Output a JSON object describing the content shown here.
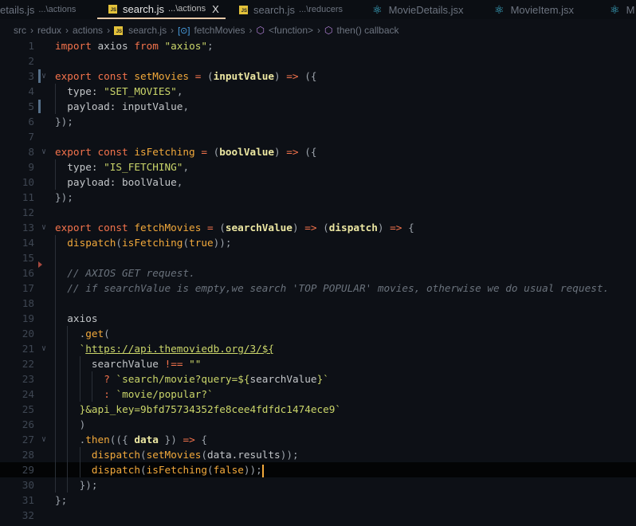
{
  "tabs": [
    {
      "name": "etails.js",
      "desc": "...\\actions",
      "icon": "js"
    },
    {
      "name": "search.js",
      "desc": "...\\actions",
      "icon": "js",
      "active": true,
      "close": "X"
    },
    {
      "name": "search.js",
      "desc": "...\\reducers",
      "icon": "js"
    },
    {
      "name": "MovieDetails.jsx",
      "desc": "",
      "icon": "react"
    },
    {
      "name": "MovieItem.jsx",
      "desc": "",
      "icon": "react"
    },
    {
      "name": "M",
      "desc": "",
      "icon": "react"
    }
  ],
  "breadcrumb": [
    "src",
    "redux",
    "actions",
    "search.js",
    "fetchMovies",
    "<function>",
    "then() callback"
  ],
  "code": [
    {
      "n": "1",
      "i": 0,
      "t": [
        [
          "kw",
          "import"
        ],
        [
          "pl",
          " axios "
        ],
        [
          "kw",
          "from"
        ],
        [
          "st",
          " \"axios\""
        ],
        [
          "pu",
          ";"
        ]
      ]
    },
    {
      "n": "2",
      "i": 0,
      "t": []
    },
    {
      "n": "3",
      "i": 0,
      "fold": true,
      "mod": true,
      "t": [
        [
          "kw",
          "export const "
        ],
        [
          "fn",
          "setMovies"
        ],
        [
          "kw",
          " = "
        ],
        [
          "pu",
          "("
        ],
        [
          "pa",
          "inputValue"
        ],
        [
          "pu",
          ") "
        ],
        [
          "kw",
          "=>"
        ],
        [
          "pu",
          " ({"
        ]
      ]
    },
    {
      "n": "4",
      "i": 1,
      "t": [
        [
          "pl",
          "type: "
        ],
        [
          "st",
          "\"SET_MOVIES\""
        ],
        [
          "pu",
          ","
        ]
      ]
    },
    {
      "n": "5",
      "i": 1,
      "mod": true,
      "t": [
        [
          "pl",
          "payload: inputValue"
        ],
        [
          "pu",
          ","
        ]
      ]
    },
    {
      "n": "6",
      "i": 0,
      "t": [
        [
          "pu",
          "});"
        ]
      ]
    },
    {
      "n": "7",
      "i": 0,
      "t": []
    },
    {
      "n": "8",
      "i": 0,
      "fold": true,
      "t": [
        [
          "kw",
          "export const "
        ],
        [
          "fn",
          "isFetching"
        ],
        [
          "kw",
          " = "
        ],
        [
          "pu",
          "("
        ],
        [
          "pa",
          "boolValue"
        ],
        [
          "pu",
          ") "
        ],
        [
          "kw",
          "=>"
        ],
        [
          "pu",
          " ({"
        ]
      ]
    },
    {
      "n": "9",
      "i": 1,
      "t": [
        [
          "pl",
          "type: "
        ],
        [
          "st",
          "\"IS_FETCHING\""
        ],
        [
          "pu",
          ","
        ]
      ]
    },
    {
      "n": "10",
      "i": 1,
      "t": [
        [
          "pl",
          "payload: boolValue"
        ],
        [
          "pu",
          ","
        ]
      ]
    },
    {
      "n": "11",
      "i": 0,
      "t": [
        [
          "pu",
          "});"
        ]
      ]
    },
    {
      "n": "12",
      "i": 0,
      "t": []
    },
    {
      "n": "13",
      "i": 0,
      "fold": true,
      "t": [
        [
          "kw",
          "export const "
        ],
        [
          "fn",
          "fetchMovies"
        ],
        [
          "kw",
          " = "
        ],
        [
          "pu",
          "("
        ],
        [
          "pa",
          "searchValue"
        ],
        [
          "pu",
          ") "
        ],
        [
          "kw",
          "=>"
        ],
        [
          "pu",
          " ("
        ],
        [
          "pa",
          "dispatch"
        ],
        [
          "pu",
          ") "
        ],
        [
          "kw",
          "=>"
        ],
        [
          "pu",
          " {"
        ]
      ]
    },
    {
      "n": "14",
      "i": 1,
      "t": [
        [
          "fn",
          "dispatch"
        ],
        [
          "pu",
          "("
        ],
        [
          "fn",
          "isFetching"
        ],
        [
          "pu",
          "("
        ],
        [
          "fn",
          "true"
        ],
        [
          "pu",
          "));"
        ]
      ]
    },
    {
      "n": "15",
      "i": 1,
      "del": true,
      "t": []
    },
    {
      "n": "16",
      "i": 1,
      "t": [
        [
          "cm",
          "// AXIOS GET request."
        ]
      ]
    },
    {
      "n": "17",
      "i": 1,
      "t": [
        [
          "cm",
          "// if searchValue is empty,we search 'TOP POPULAR' movies, otherwise we do usual request."
        ]
      ]
    },
    {
      "n": "18",
      "i": 1,
      "t": []
    },
    {
      "n": "19",
      "i": 1,
      "t": [
        [
          "pl",
          "axios"
        ]
      ]
    },
    {
      "n": "20",
      "i": 2,
      "t": [
        [
          "pu",
          "."
        ],
        [
          "fn",
          "get"
        ],
        [
          "pu",
          "("
        ]
      ]
    },
    {
      "n": "21",
      "i": 2,
      "fold": true,
      "t": [
        [
          "st",
          "`"
        ],
        [
          "ln2",
          "https://api.themoviedb.org/3/${"
        ]
      ]
    },
    {
      "n": "22",
      "i": 3,
      "t": [
        [
          "pl",
          "searchValue "
        ],
        [
          "kw",
          "!=="
        ],
        [
          "st",
          " \"\""
        ]
      ]
    },
    {
      "n": "23",
      "i": 4,
      "t": [
        [
          "kw",
          "? "
        ],
        [
          "st",
          "`search/movie?query=${"
        ],
        [
          "pl",
          "searchValue"
        ],
        [
          "st",
          "}`"
        ]
      ]
    },
    {
      "n": "24",
      "i": 4,
      "t": [
        [
          "kw",
          ": "
        ],
        [
          "st",
          "`movie/popular?`"
        ]
      ]
    },
    {
      "n": "25",
      "i": 2,
      "t": [
        [
          "st",
          "}&api_key=9bfd75734352fe8cee4fdfdc1474ece9`"
        ]
      ]
    },
    {
      "n": "26",
      "i": 2,
      "t": [
        [
          "pu",
          ")"
        ]
      ]
    },
    {
      "n": "27",
      "i": 2,
      "fold": true,
      "t": [
        [
          "pu",
          "."
        ],
        [
          "fn",
          "then"
        ],
        [
          "pu",
          "(({ "
        ],
        [
          "pa",
          "data"
        ],
        [
          "pu",
          " }) "
        ],
        [
          "kw",
          "=>"
        ],
        [
          "pu",
          " {"
        ]
      ]
    },
    {
      "n": "28",
      "i": 3,
      "t": [
        [
          "fn",
          "dispatch"
        ],
        [
          "pu",
          "("
        ],
        [
          "fn",
          "setMovies"
        ],
        [
          "pu",
          "("
        ],
        [
          "pl",
          "data.results"
        ],
        [
          "pu",
          "));"
        ]
      ]
    },
    {
      "n": "29",
      "i": 3,
      "current": true,
      "t": [
        [
          "fn",
          "dispatch"
        ],
        [
          "pu",
          "("
        ],
        [
          "fn",
          "isFetching"
        ],
        [
          "pu",
          "("
        ],
        [
          "fn",
          "false"
        ],
        [
          "pu",
          "));"
        ]
      ]
    },
    {
      "n": "30",
      "i": 2,
      "t": [
        [
          "pu",
          "});"
        ]
      ]
    },
    {
      "n": "31",
      "i": 0,
      "t": [
        [
          "pu",
          "};"
        ]
      ]
    },
    {
      "n": "32",
      "i": 0,
      "t": []
    }
  ]
}
